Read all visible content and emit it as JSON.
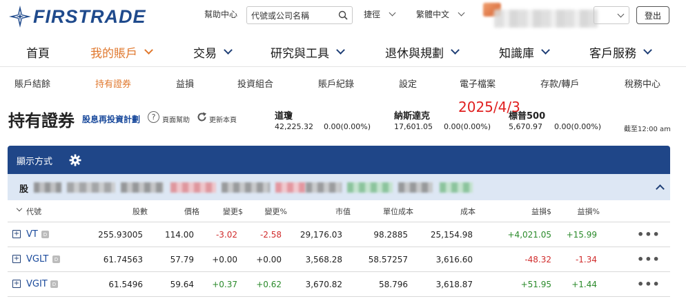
{
  "brand": {
    "name": "FIRSTRADE",
    "color": "#1f4a8c"
  },
  "topbar": {
    "help": "幫助中心",
    "search_placeholder": "代號或公司名稱",
    "shortcut": "捷徑",
    "language": "繁體中文",
    "logout": "登出"
  },
  "mainnav": [
    {
      "label": "首頁"
    },
    {
      "label": "我的賬戶"
    },
    {
      "label": "交易"
    },
    {
      "label": "研究與工具"
    },
    {
      "label": "退休與規劃"
    },
    {
      "label": "知識庫"
    },
    {
      "label": "客戶服務"
    }
  ],
  "subnav": [
    "賬戶結餘",
    "持有證券",
    "益損",
    "投資組合",
    "賬戶紀錄",
    "設定",
    "電子檔案",
    "存款/轉戶",
    "稅務中心"
  ],
  "page": {
    "title": "持有證券",
    "drip": "股息再投資計劃",
    "help": "頁面幫助",
    "refresh": "更新本頁",
    "date_stamp": "2025/4/3",
    "as_of": "截至12:00 am"
  },
  "indices": [
    {
      "name": "道瓊",
      "value": "42,225.32",
      "change": "0.00(0.00%)"
    },
    {
      "name": "納斯達克",
      "value": "17,601.05",
      "change": "0.00(0.00%)"
    },
    {
      "name": "標普500",
      "value": "5,670.97",
      "change": "0.00(0.00%)"
    }
  ],
  "panel": {
    "title": "顯示方式",
    "group_label": "股"
  },
  "columns": [
    "代號",
    "股數",
    "價格",
    "變更$",
    "變更%",
    "市值",
    "單位成本",
    "成本",
    "益損$",
    "益損%"
  ],
  "holdings": [
    {
      "symbol": "VT",
      "shares": "255.93005",
      "price": "114.00",
      "chg": "-3.02",
      "chg_pct": "-2.58",
      "mkt_value": "29,176.03",
      "unit_cost": "98.2885",
      "cost": "25,154.98",
      "gl": "+4,021.05",
      "gl_pct": "+15.99"
    },
    {
      "symbol": "VGLT",
      "shares": "61.74563",
      "price": "57.79",
      "chg": "+0.00",
      "chg_pct": "+0.00",
      "mkt_value": "3,568.28",
      "unit_cost": "58.57257",
      "cost": "3,616.60",
      "gl": "-48.32",
      "gl_pct": "-1.34"
    },
    {
      "symbol": "VGIT",
      "shares": "61.5496",
      "price": "59.64",
      "chg": "+0.37",
      "chg_pct": "+0.62",
      "mkt_value": "3,670.82",
      "unit_cost": "58.796",
      "cost": "3,618.87",
      "gl": "+51.95",
      "gl_pct": "+1.44"
    }
  ],
  "colors": {
    "accent": "#e0782e",
    "panel": "#1f4688",
    "group": "#dde7f4",
    "negative": "#d02b2b",
    "positive": "#2a8a2a",
    "date_stamp": "#e02020"
  }
}
